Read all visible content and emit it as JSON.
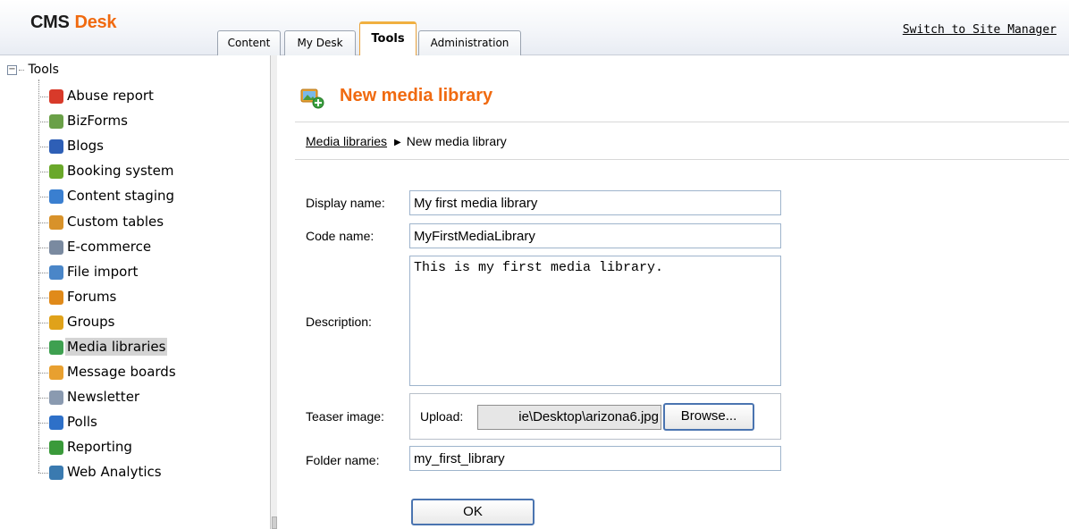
{
  "header": {
    "logo_part1": "CMS",
    "logo_part2": "Desk",
    "tabs": [
      {
        "label": "Content"
      },
      {
        "label": "My Desk"
      },
      {
        "label": "Tools",
        "active": true
      },
      {
        "label": "Administration"
      }
    ],
    "switch_link": "Switch to Site Manager"
  },
  "tree": {
    "root_label": "Tools",
    "items": [
      {
        "label": "Abuse report",
        "icon": "abuse-report-icon",
        "color": "#d83a2a"
      },
      {
        "label": "BizForms",
        "icon": "bizforms-icon",
        "color": "#6aa048"
      },
      {
        "label": "Blogs",
        "icon": "blogs-icon",
        "color": "#2e5fb6"
      },
      {
        "label": "Booking system",
        "icon": "booking-system-icon",
        "color": "#6aa82a"
      },
      {
        "label": "Content staging",
        "icon": "content-staging-icon",
        "color": "#3a7fd0"
      },
      {
        "label": "Custom tables",
        "icon": "custom-tables-icon",
        "color": "#d8922a"
      },
      {
        "label": "E-commerce",
        "icon": "ecommerce-icon",
        "color": "#7a8aa0"
      },
      {
        "label": "File import",
        "icon": "file-import-icon",
        "color": "#4a86c8"
      },
      {
        "label": "Forums",
        "icon": "forums-icon",
        "color": "#e08a1a"
      },
      {
        "label": "Groups",
        "icon": "groups-icon",
        "color": "#e0a21a"
      },
      {
        "label": "Media libraries",
        "icon": "media-libraries-icon",
        "color": "#3ea050",
        "selected": true
      },
      {
        "label": "Message boards",
        "icon": "message-boards-icon",
        "color": "#e8a030"
      },
      {
        "label": "Newsletter",
        "icon": "newsletter-icon",
        "color": "#8a9ab0"
      },
      {
        "label": "Polls",
        "icon": "polls-icon",
        "color": "#2e70c8"
      },
      {
        "label": "Reporting",
        "icon": "reporting-icon",
        "color": "#3a9a3a"
      },
      {
        "label": "Web Analytics",
        "icon": "web-analytics-icon",
        "color": "#3a7ab0"
      }
    ]
  },
  "page": {
    "title": "New media library",
    "breadcrumb_link": "Media libraries",
    "breadcrumb_current": "New media library"
  },
  "form": {
    "display_name_label": "Display name:",
    "display_name_value": "My first media library",
    "code_name_label": "Code name:",
    "code_name_value": "MyFirstMediaLibrary",
    "description_label": "Description:",
    "description_value": "This is my first media library.",
    "teaser_label": "Teaser image:",
    "upload_label": "Upload:",
    "upload_path": "ie\\Desktop\\arizona6.jpg",
    "browse_label": "Browse...",
    "folder_label": "Folder name:",
    "folder_value": "my_first_library",
    "ok_label": "OK"
  }
}
